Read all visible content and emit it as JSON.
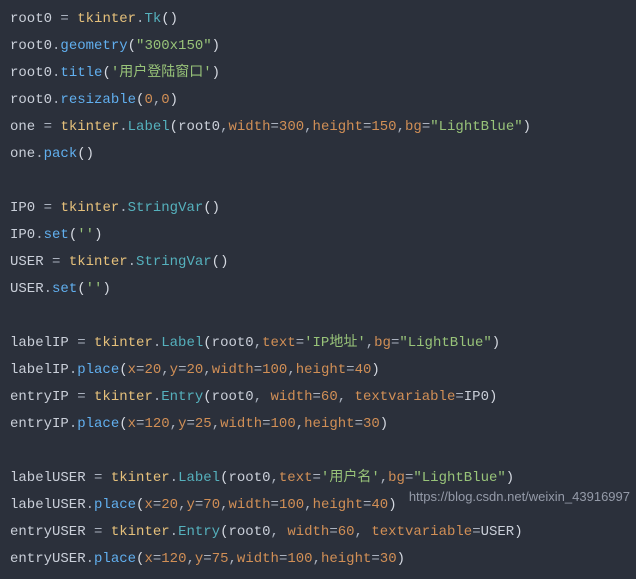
{
  "code": {
    "l01": {
      "v": "root0",
      "mod": "tkinter",
      "cls": "Tk"
    },
    "l02": {
      "v": "root0",
      "m": "geometry",
      "arg": "\"300x150\""
    },
    "l03": {
      "v": "root0",
      "m": "title",
      "arg": "'用户登陆窗口'"
    },
    "l04": {
      "v": "root0",
      "m": "resizable",
      "a1": "0",
      "a2": "0"
    },
    "l05": {
      "v": "one",
      "mod": "tkinter",
      "cls": "Label",
      "arg0": "root0",
      "kw1": "width",
      "kv1": "300",
      "kw2": "height",
      "kv2": "150",
      "kw3": "bg",
      "kv3": "\"LightBlue\""
    },
    "l06": {
      "v": "one",
      "m": "pack"
    },
    "l07": {
      "v": "IP0",
      "mod": "tkinter",
      "cls": "StringVar"
    },
    "l08": {
      "v": "IP0",
      "m": "set",
      "arg": "''"
    },
    "l09": {
      "v": "USER",
      "mod": "tkinter",
      "cls": "StringVar"
    },
    "l10": {
      "v": "USER",
      "m": "set",
      "arg": "''"
    },
    "l11": {
      "v": "labelIP",
      "mod": "tkinter",
      "cls": "Label",
      "arg0": "root0",
      "kw1": "text",
      "kv1": "'IP地址'",
      "kw2": "bg",
      "kv2": "\"LightBlue\""
    },
    "l12": {
      "v": "labelIP",
      "m": "place",
      "kw1": "x",
      "kv1": "20",
      "kw2": "y",
      "kv2": "20",
      "kw3": "width",
      "kv3": "100",
      "kw4": "height",
      "kv4": "40"
    },
    "l13": {
      "v": "entryIP",
      "mod": "tkinter",
      "cls": "Entry",
      "arg0": "root0",
      "kw1": "width",
      "kv1": "60",
      "kw2": "textvariable",
      "kv2": "IP0"
    },
    "l14": {
      "v": "entryIP",
      "m": "place",
      "kw1": "x",
      "kv1": "120",
      "kw2": "y",
      "kv2": "25",
      "kw3": "width",
      "kv3": "100",
      "kw4": "height",
      "kv4": "30"
    },
    "l15": {
      "v": "labelUSER",
      "mod": "tkinter",
      "cls": "Label",
      "arg0": "root0",
      "kw1": "text",
      "kv1": "'用户名'",
      "kw2": "bg",
      "kv2": "\"LightBlue\""
    },
    "l16": {
      "v": "labelUSER",
      "m": "place",
      "kw1": "x",
      "kv1": "20",
      "kw2": "y",
      "kv2": "70",
      "kw3": "width",
      "kv3": "100",
      "kw4": "height",
      "kv4": "40"
    },
    "l17": {
      "v": "entryUSER",
      "mod": "tkinter",
      "cls": "Entry",
      "arg0": "root0",
      "kw1": "width",
      "kv1": "60",
      "kw2": "textvariable",
      "kv2": "USER"
    },
    "l18": {
      "v": "entryUSER",
      "m": "place",
      "kw1": "x",
      "kv1": "120",
      "kw2": "y",
      "kv2": "75",
      "kw3": "width",
      "kv3": "100",
      "kw4": "height",
      "kv4": "30"
    }
  },
  "watermark": "https://blog.csdn.net/weixin_43916997"
}
